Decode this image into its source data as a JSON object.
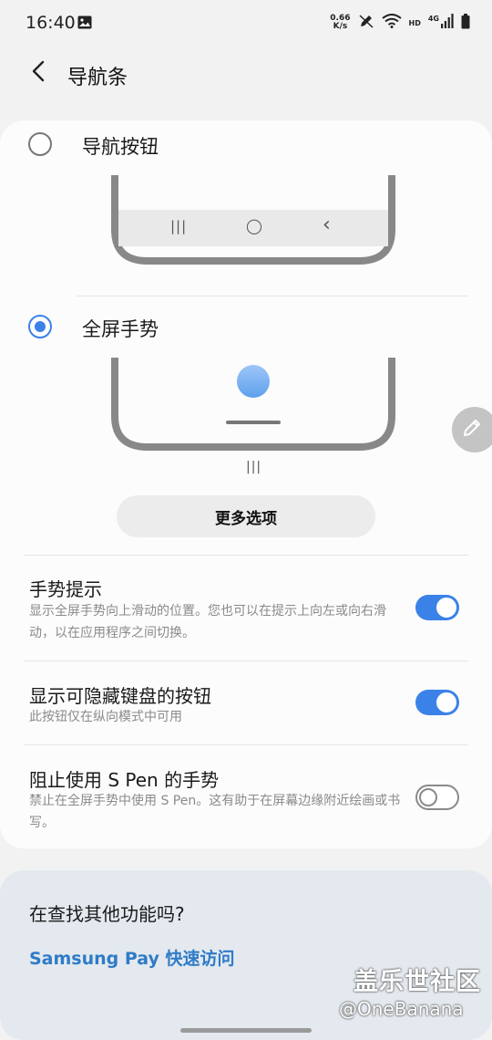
{
  "status_bar": {
    "time": "16:40",
    "net_speed_value": "0.66",
    "net_speed_unit": "K/s",
    "hd": "HD",
    "network_type": "4G"
  },
  "header": {
    "title": "导航条"
  },
  "nav_options": [
    {
      "label": "导航按钮",
      "selected": false
    },
    {
      "label": "全屏手势",
      "selected": true
    }
  ],
  "nav_buttons_preview": {
    "recents_glyph": "|||",
    "home_glyph": "◯",
    "back_glyph": "‹"
  },
  "gesture_preview": {
    "hint_glyph": "|||"
  },
  "more_options_label": "更多选项",
  "settings": [
    {
      "title": "手势提示",
      "description": "显示全屏手势向上滑动的位置。您也可以在提示上向左或向右滑动，以在应用程序之间切换。",
      "enabled": true
    },
    {
      "title": "显示可隐藏键盘的按钮",
      "description": "此按钮仅在纵向模式中可用",
      "enabled": true
    },
    {
      "title": "阻止使用 S Pen 的手势",
      "description": "禁止在全屏手势中使用 S Pen。这有助于在屏幕边缘附近绘画或书写。",
      "enabled": false
    }
  ],
  "suggestion": {
    "title": "在查找其他功能吗?",
    "link_label": "Samsung Pay 快速访问"
  },
  "watermark": {
    "site": "盖乐世社区",
    "user": "@OneBanana"
  },
  "colors": {
    "accent": "#3b82e8",
    "link": "#2f7bc7",
    "card_bg": "#fcfcfc",
    "page_bg": "#f2f2f2",
    "suggest_bg": "#e3e9ee"
  },
  "icons": {
    "back": "chevron-left-icon",
    "gallery": "image-icon",
    "edit": "pencil-icon"
  }
}
